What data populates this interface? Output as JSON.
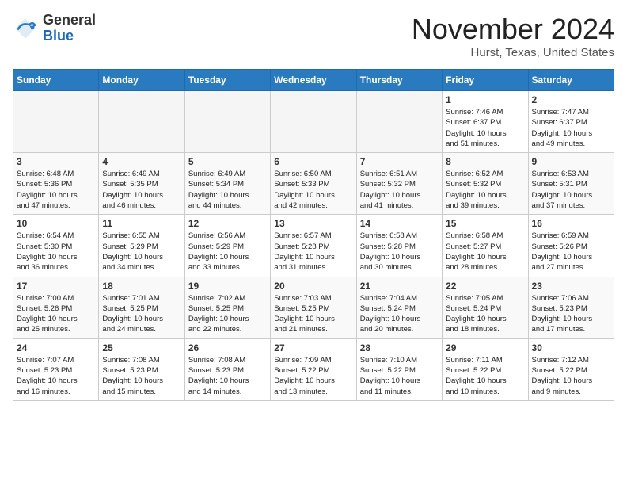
{
  "header": {
    "logo_general": "General",
    "logo_blue": "Blue",
    "month_title": "November 2024",
    "location": "Hurst, Texas, United States"
  },
  "days_of_week": [
    "Sunday",
    "Monday",
    "Tuesday",
    "Wednesday",
    "Thursday",
    "Friday",
    "Saturday"
  ],
  "weeks": [
    [
      {
        "num": "",
        "info": ""
      },
      {
        "num": "",
        "info": ""
      },
      {
        "num": "",
        "info": ""
      },
      {
        "num": "",
        "info": ""
      },
      {
        "num": "",
        "info": ""
      },
      {
        "num": "1",
        "info": "Sunrise: 7:46 AM\nSunset: 6:37 PM\nDaylight: 10 hours\nand 51 minutes."
      },
      {
        "num": "2",
        "info": "Sunrise: 7:47 AM\nSunset: 6:37 PM\nDaylight: 10 hours\nand 49 minutes."
      }
    ],
    [
      {
        "num": "3",
        "info": "Sunrise: 6:48 AM\nSunset: 5:36 PM\nDaylight: 10 hours\nand 47 minutes."
      },
      {
        "num": "4",
        "info": "Sunrise: 6:49 AM\nSunset: 5:35 PM\nDaylight: 10 hours\nand 46 minutes."
      },
      {
        "num": "5",
        "info": "Sunrise: 6:49 AM\nSunset: 5:34 PM\nDaylight: 10 hours\nand 44 minutes."
      },
      {
        "num": "6",
        "info": "Sunrise: 6:50 AM\nSunset: 5:33 PM\nDaylight: 10 hours\nand 42 minutes."
      },
      {
        "num": "7",
        "info": "Sunrise: 6:51 AM\nSunset: 5:32 PM\nDaylight: 10 hours\nand 41 minutes."
      },
      {
        "num": "8",
        "info": "Sunrise: 6:52 AM\nSunset: 5:32 PM\nDaylight: 10 hours\nand 39 minutes."
      },
      {
        "num": "9",
        "info": "Sunrise: 6:53 AM\nSunset: 5:31 PM\nDaylight: 10 hours\nand 37 minutes."
      }
    ],
    [
      {
        "num": "10",
        "info": "Sunrise: 6:54 AM\nSunset: 5:30 PM\nDaylight: 10 hours\nand 36 minutes."
      },
      {
        "num": "11",
        "info": "Sunrise: 6:55 AM\nSunset: 5:29 PM\nDaylight: 10 hours\nand 34 minutes."
      },
      {
        "num": "12",
        "info": "Sunrise: 6:56 AM\nSunset: 5:29 PM\nDaylight: 10 hours\nand 33 minutes."
      },
      {
        "num": "13",
        "info": "Sunrise: 6:57 AM\nSunset: 5:28 PM\nDaylight: 10 hours\nand 31 minutes."
      },
      {
        "num": "14",
        "info": "Sunrise: 6:58 AM\nSunset: 5:28 PM\nDaylight: 10 hours\nand 30 minutes."
      },
      {
        "num": "15",
        "info": "Sunrise: 6:58 AM\nSunset: 5:27 PM\nDaylight: 10 hours\nand 28 minutes."
      },
      {
        "num": "16",
        "info": "Sunrise: 6:59 AM\nSunset: 5:26 PM\nDaylight: 10 hours\nand 27 minutes."
      }
    ],
    [
      {
        "num": "17",
        "info": "Sunrise: 7:00 AM\nSunset: 5:26 PM\nDaylight: 10 hours\nand 25 minutes."
      },
      {
        "num": "18",
        "info": "Sunrise: 7:01 AM\nSunset: 5:25 PM\nDaylight: 10 hours\nand 24 minutes."
      },
      {
        "num": "19",
        "info": "Sunrise: 7:02 AM\nSunset: 5:25 PM\nDaylight: 10 hours\nand 22 minutes."
      },
      {
        "num": "20",
        "info": "Sunrise: 7:03 AM\nSunset: 5:25 PM\nDaylight: 10 hours\nand 21 minutes."
      },
      {
        "num": "21",
        "info": "Sunrise: 7:04 AM\nSunset: 5:24 PM\nDaylight: 10 hours\nand 20 minutes."
      },
      {
        "num": "22",
        "info": "Sunrise: 7:05 AM\nSunset: 5:24 PM\nDaylight: 10 hours\nand 18 minutes."
      },
      {
        "num": "23",
        "info": "Sunrise: 7:06 AM\nSunset: 5:23 PM\nDaylight: 10 hours\nand 17 minutes."
      }
    ],
    [
      {
        "num": "24",
        "info": "Sunrise: 7:07 AM\nSunset: 5:23 PM\nDaylight: 10 hours\nand 16 minutes."
      },
      {
        "num": "25",
        "info": "Sunrise: 7:08 AM\nSunset: 5:23 PM\nDaylight: 10 hours\nand 15 minutes."
      },
      {
        "num": "26",
        "info": "Sunrise: 7:08 AM\nSunset: 5:23 PM\nDaylight: 10 hours\nand 14 minutes."
      },
      {
        "num": "27",
        "info": "Sunrise: 7:09 AM\nSunset: 5:22 PM\nDaylight: 10 hours\nand 13 minutes."
      },
      {
        "num": "28",
        "info": "Sunrise: 7:10 AM\nSunset: 5:22 PM\nDaylight: 10 hours\nand 11 minutes."
      },
      {
        "num": "29",
        "info": "Sunrise: 7:11 AM\nSunset: 5:22 PM\nDaylight: 10 hours\nand 10 minutes."
      },
      {
        "num": "30",
        "info": "Sunrise: 7:12 AM\nSunset: 5:22 PM\nDaylight: 10 hours\nand 9 minutes."
      }
    ]
  ]
}
